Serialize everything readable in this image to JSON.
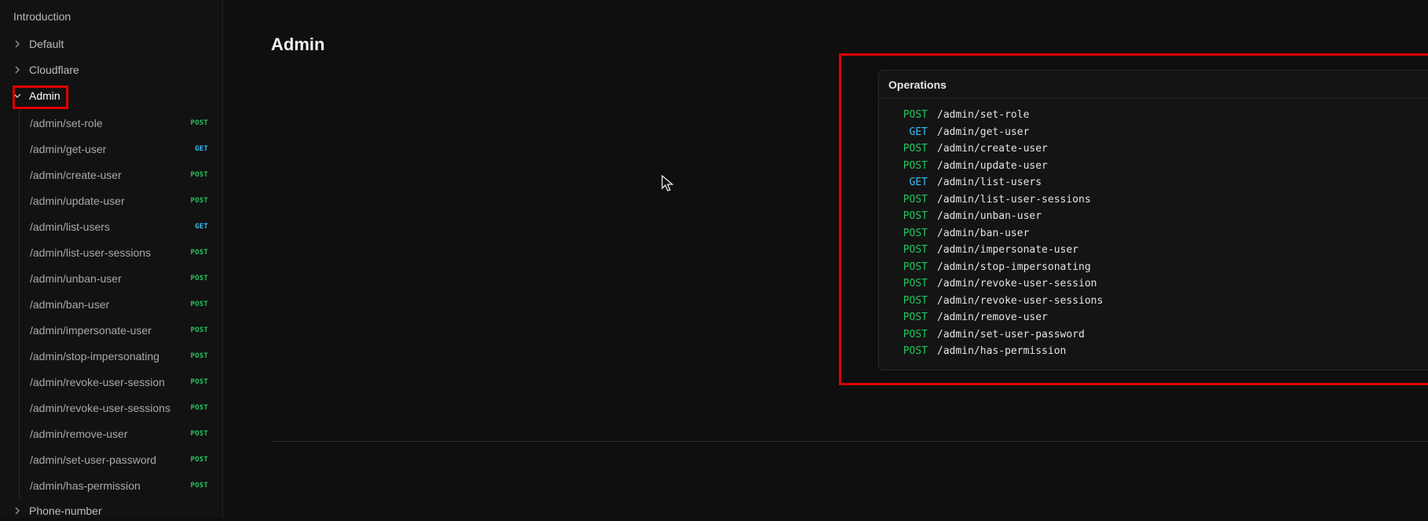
{
  "sidebar": {
    "intro": "Introduction",
    "groups": [
      {
        "label": "Default",
        "expanded": false
      },
      {
        "label": "Cloudflare",
        "expanded": false
      },
      {
        "label": "Admin",
        "expanded": true
      },
      {
        "label": "Phone-number",
        "expanded": false
      }
    ],
    "admin_items": [
      {
        "path": "/admin/set-role",
        "method": "POST"
      },
      {
        "path": "/admin/get-user",
        "method": "GET"
      },
      {
        "path": "/admin/create-user",
        "method": "POST"
      },
      {
        "path": "/admin/update-user",
        "method": "POST"
      },
      {
        "path": "/admin/list-users",
        "method": "GET"
      },
      {
        "path": "/admin/list-user-sessions",
        "method": "POST"
      },
      {
        "path": "/admin/unban-user",
        "method": "POST"
      },
      {
        "path": "/admin/ban-user",
        "method": "POST"
      },
      {
        "path": "/admin/impersonate-user",
        "method": "POST"
      },
      {
        "path": "/admin/stop-impersonating",
        "method": "POST"
      },
      {
        "path": "/admin/revoke-user-session",
        "method": "POST"
      },
      {
        "path": "/admin/revoke-user-sessions",
        "method": "POST"
      },
      {
        "path": "/admin/remove-user",
        "method": "POST"
      },
      {
        "path": "/admin/set-user-password",
        "method": "POST"
      },
      {
        "path": "/admin/has-permission",
        "method": "POST"
      }
    ]
  },
  "main": {
    "title": "Admin",
    "operations": {
      "heading": "Operations",
      "items": [
        {
          "method": "POST",
          "path": "/admin/set-role"
        },
        {
          "method": "GET",
          "path": "/admin/get-user"
        },
        {
          "method": "POST",
          "path": "/admin/create-user"
        },
        {
          "method": "POST",
          "path": "/admin/update-user"
        },
        {
          "method": "GET",
          "path": "/admin/list-users"
        },
        {
          "method": "POST",
          "path": "/admin/list-user-sessions"
        },
        {
          "method": "POST",
          "path": "/admin/unban-user"
        },
        {
          "method": "POST",
          "path": "/admin/ban-user"
        },
        {
          "method": "POST",
          "path": "/admin/impersonate-user"
        },
        {
          "method": "POST",
          "path": "/admin/stop-impersonating"
        },
        {
          "method": "POST",
          "path": "/admin/revoke-user-session"
        },
        {
          "method": "POST",
          "path": "/admin/revoke-user-sessions"
        },
        {
          "method": "POST",
          "path": "/admin/remove-user"
        },
        {
          "method": "POST",
          "path": "/admin/set-user-password"
        },
        {
          "method": "POST",
          "path": "/admin/has-permission"
        }
      ]
    }
  },
  "colors": {
    "post": "#22c55e",
    "get": "#38bdf8",
    "highlight": "#e00000",
    "background": "#0f0f0f"
  },
  "icons": {
    "chevron_right": "chevron-right-icon",
    "chevron_down": "chevron-down-icon",
    "cursor": "mouse-pointer-icon"
  }
}
